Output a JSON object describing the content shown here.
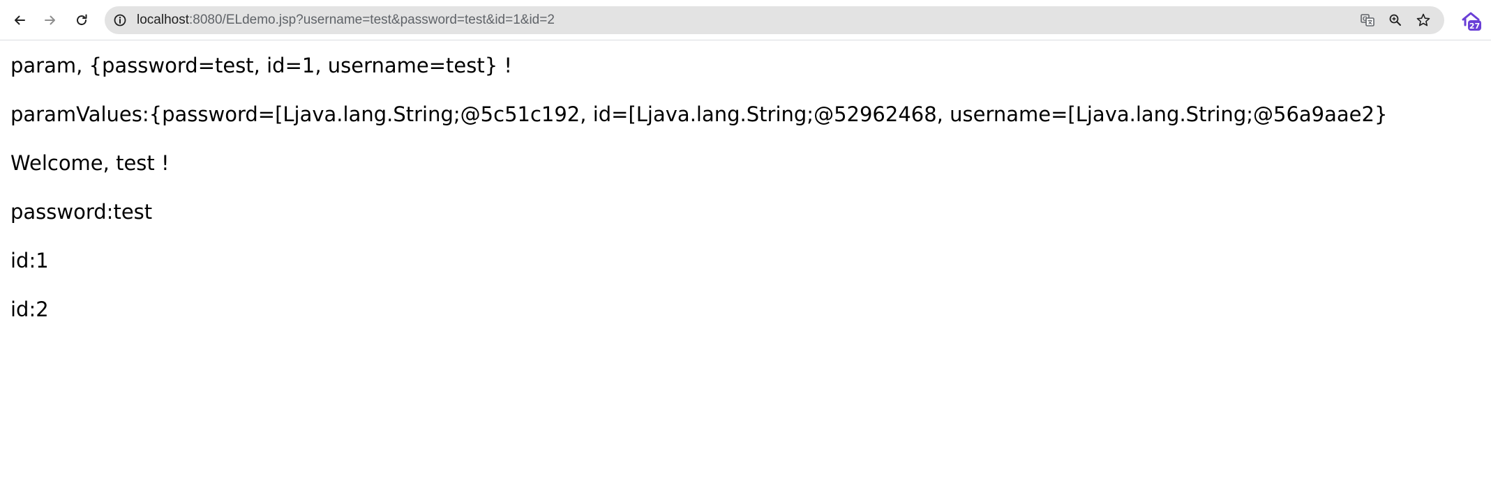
{
  "browser": {
    "url_host": "localhost",
    "url_rest": ":8080/ELdemo.jsp?username=test&password=test&id=1&id=2",
    "extension_badge": "27",
    "icons": {
      "back": "arrow-left-icon",
      "forward": "arrow-right-icon",
      "reload": "reload-icon",
      "site_info": "info-icon",
      "translate": "translate-icon",
      "zoom": "zoom-icon",
      "bookmark": "star-icon",
      "extension": "extension-icon"
    },
    "colors": {
      "omnibox_bg": "#e3e3e3",
      "extension_accent": "#6a3fd6"
    }
  },
  "page": {
    "lines": [
      "param, {password=test, id=1, username=test} !",
      "paramValues:{password=[Ljava.lang.String;@5c51c192, id=[Ljava.lang.String;@52962468, username=[Ljava.lang.String;@56a9aae2}",
      "Welcome, test !",
      "password:test",
      "id:1",
      "id:2"
    ]
  }
}
